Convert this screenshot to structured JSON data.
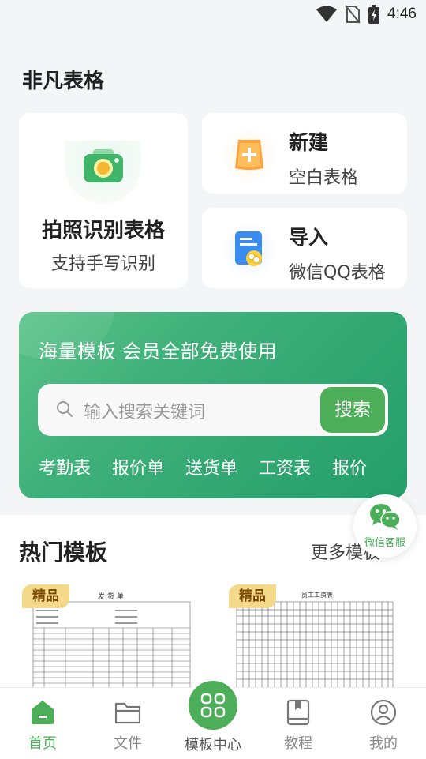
{
  "status": {
    "time": "4:46"
  },
  "app": {
    "title": "非凡表格"
  },
  "cards": {
    "photo": {
      "title": "拍照识别表格",
      "subtitle": "支持手写识别"
    },
    "new": {
      "title": "新建",
      "subtitle": "空白表格"
    },
    "import": {
      "title": "导入",
      "subtitle": "微信QQ表格"
    }
  },
  "banner": {
    "title": "海量模板 会员全部免费使用",
    "search_placeholder": "输入搜索关键词",
    "search_button": "搜索",
    "tags": [
      "考勤表",
      "报价单",
      "送货单",
      "工资表",
      "报价"
    ]
  },
  "hot": {
    "title": "热门模板",
    "more": "更多模板",
    "badge": "精品",
    "thumb1_title": "发 货 单",
    "thumb2_title": "员工工资表"
  },
  "floating": {
    "label": "微信客服"
  },
  "nav": [
    {
      "label": "首页",
      "icon": "home-icon",
      "active": true
    },
    {
      "label": "文件",
      "icon": "folder-icon",
      "active": false
    },
    {
      "label": "模板中心",
      "icon": "grid-icon",
      "active": false
    },
    {
      "label": "教程",
      "icon": "book-icon",
      "active": false
    },
    {
      "label": "我的",
      "icon": "user-icon",
      "active": false
    }
  ],
  "colors": {
    "accent": "#4cae59",
    "banner": "#3fb07a",
    "badge": "#f5d98b"
  }
}
